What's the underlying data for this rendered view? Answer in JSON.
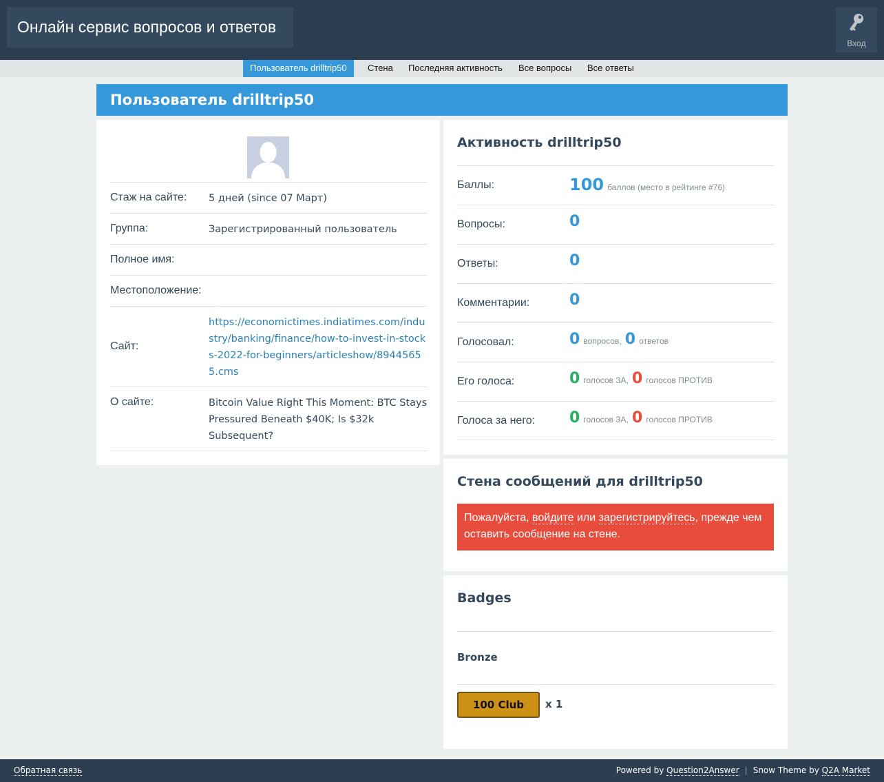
{
  "header": {
    "site_title": "Онлайн сервис вопросов и ответов",
    "login_label": "Вход"
  },
  "subnav": {
    "items": [
      {
        "label": "Пользователь drilltrip50",
        "active": true
      },
      {
        "label": "Стена",
        "active": false
      },
      {
        "label": "Последняя активность",
        "active": false
      },
      {
        "label": "Все вопросы",
        "active": false
      },
      {
        "label": "Все ответы",
        "active": false
      }
    ]
  },
  "page_title": "Пользователь drilltrip50",
  "profile": {
    "rows": [
      {
        "label": "Стаж на сайте:",
        "value": "5 дней (since 07 Март)"
      },
      {
        "label": "Группа:",
        "value": "Зарегистрированный пользователь"
      },
      {
        "label": "Полное имя:",
        "value": ""
      },
      {
        "label": "Местоположение:",
        "value": ""
      },
      {
        "label": "Сайт:",
        "value": "https://economictimes.indiatimes.com/industry/banking/finance/how-to-invest-in-stocks-2022-for-beginners/articleshow/89445655.cms"
      },
      {
        "label": "О сайте:",
        "value": "Bitcoin Value Right This Moment: BTC Stays Pressured Beneath $40K; Is $32k Subsequent?"
      }
    ]
  },
  "activity": {
    "title": "Активность drilltrip50",
    "points": {
      "label": "Баллы:",
      "value": "100",
      "note": "баллов (место в рейтинге #76)"
    },
    "questions": {
      "label": "Вопросы:",
      "value": "0"
    },
    "answers": {
      "label": "Ответы:",
      "value": "0"
    },
    "comments": {
      "label": "Комментарии:",
      "value": "0"
    },
    "voted": {
      "label": "Голосовал:",
      "q_value": "0",
      "q_text": "вопросов,",
      "a_value": "0",
      "a_text": "ответов"
    },
    "his_votes": {
      "label": "Его голоса:",
      "up_value": "0",
      "up_text": "голосов ЗА,",
      "down_value": "0",
      "down_text": "голосов ПРОТИВ"
    },
    "votes_for_him": {
      "label": "Голоса за него:",
      "up_value": "0",
      "up_text": "голосов ЗА,",
      "down_value": "0",
      "down_text": "голосов ПРОТИВ"
    }
  },
  "wall": {
    "title": "Стена сообщений для drilltrip50",
    "msg_prefix": "Пожалуйста, ",
    "login_link": "войдите",
    "msg_or": " или ",
    "register_link": "зарегистрируйтесь",
    "msg_suffix": ", прежде чем оставить сообщение на стене."
  },
  "badges": {
    "title": "Badges",
    "tier": "Bronze",
    "badge_name": "100 Club",
    "badge_count": "x 1"
  },
  "footer": {
    "feedback": "Обратная связь",
    "powered_by": "Powered by ",
    "q2a": "Question2Answer",
    "separator": "|",
    "theme_by": "Snow Theme by ",
    "q2a_market": "Q2A Market"
  },
  "colors": {
    "header_bg": "#2c3e50",
    "accent_blue": "#3498db",
    "alert_red": "#e74c3c",
    "up_green": "#27ae60",
    "badge_bronze": "#cd9116"
  }
}
